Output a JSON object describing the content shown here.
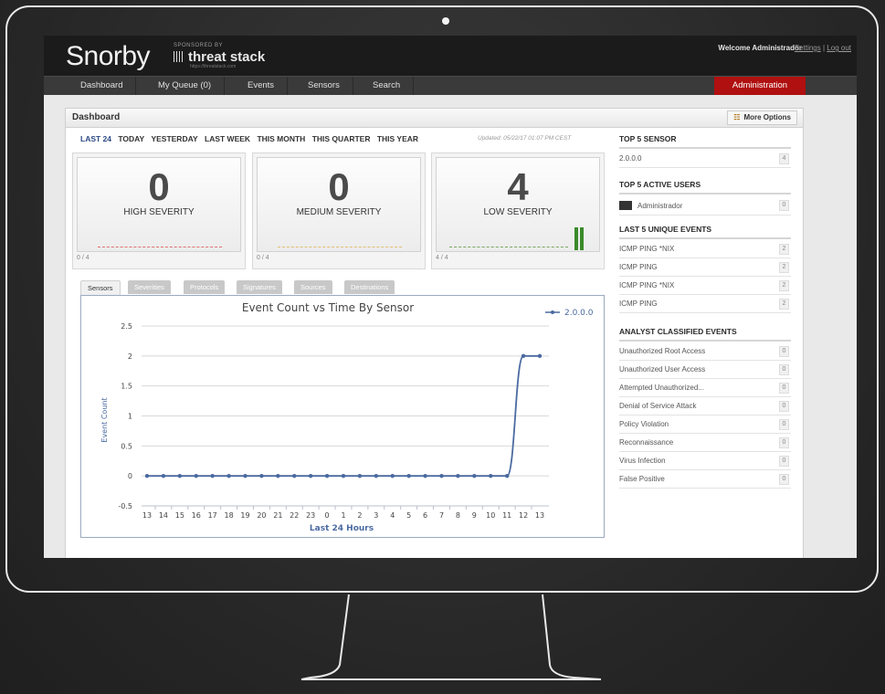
{
  "header": {
    "logo": "Snorby",
    "sponsored_by": "SPONSORED BY",
    "sponsor_name": "threat stack",
    "sponsor_url": "https://threatstack.com",
    "welcome": "Welcome Administrador",
    "settings": "Settings",
    "separator": "|",
    "logout": "Log out"
  },
  "nav": {
    "items": [
      "Dashboard",
      "My Queue (0)",
      "Events",
      "Sensors",
      "Search"
    ],
    "admin": "Administration"
  },
  "dashboard": {
    "title": "Dashboard",
    "more_options": "More Options",
    "more_options_icon": "grid-icon",
    "timeframes": [
      "LAST 24",
      "TODAY",
      "YESTERDAY",
      "LAST WEEK",
      "THIS MONTH",
      "THIS QUARTER",
      "THIS YEAR"
    ],
    "updated": "Updated: 05/22/17 01:07 PM CEST",
    "cards": [
      {
        "count": "0",
        "label": "HIGH SEVERITY",
        "fraction": "0 / 4",
        "color": "#e07070"
      },
      {
        "count": "0",
        "label": "MEDIUM SEVERITY",
        "fraction": "0 / 4",
        "color": "#e0c070"
      },
      {
        "count": "4",
        "label": "LOW SEVERITY",
        "fraction": "4 / 4",
        "color": "#7aa860"
      }
    ],
    "tabs": [
      "Sensors",
      "Severities",
      "Protocols",
      "Signatures",
      "Sources",
      "Destinations"
    ]
  },
  "chart_data": {
    "type": "line",
    "title": "Event Count vs Time By Sensor",
    "xlabel": "Last 24 Hours",
    "ylabel": "Event Count",
    "categories": [
      "13",
      "14",
      "15",
      "16",
      "17",
      "18",
      "19",
      "20",
      "21",
      "22",
      "23",
      "0",
      "1",
      "2",
      "3",
      "4",
      "5",
      "6",
      "7",
      "8",
      "9",
      "10",
      "11",
      "12",
      "13"
    ],
    "series": [
      {
        "name": "2.0.0.0",
        "values": [
          0,
          0,
          0,
          0,
          0,
          0,
          0,
          0,
          0,
          0,
          0,
          0,
          0,
          0,
          0,
          0,
          0,
          0,
          0,
          0,
          0,
          0,
          0,
          2,
          2
        ],
        "color": "#4a6aa0"
      }
    ],
    "ylim": [
      -0.5,
      2.5
    ],
    "yticks": [
      "-0.5",
      "0",
      "0.5",
      "1",
      "1.5",
      "2",
      "2.5"
    ],
    "grid": true,
    "legend": "top-right"
  },
  "sidebar": {
    "top_sensor": {
      "title": "TOP 5 SENSOR",
      "items": [
        {
          "label": "2.0.0.0",
          "count": "4"
        }
      ]
    },
    "active_users": {
      "title": "TOP 5 ACTIVE USERS",
      "items": [
        {
          "label": "Administrador",
          "count": "0"
        }
      ]
    },
    "unique_events": {
      "title": "LAST 5 UNIQUE EVENTS",
      "items": [
        {
          "label": "ICMP PING *NIX",
          "count": "2"
        },
        {
          "label": "ICMP PING",
          "count": "2"
        },
        {
          "label": "ICMP PING *NIX",
          "count": "2"
        },
        {
          "label": "ICMP PING",
          "count": "2"
        }
      ]
    },
    "classified": {
      "title": "ANALYST CLASSIFIED EVENTS",
      "items": [
        {
          "label": "Unauthorized Root Access",
          "count": "0"
        },
        {
          "label": "Unauthorized User Access",
          "count": "0"
        },
        {
          "label": "Attempted Unauthorized...",
          "count": "0"
        },
        {
          "label": "Denial of Service Attack",
          "count": "0"
        },
        {
          "label": "Policy Violation",
          "count": "0"
        },
        {
          "label": "Reconnaissance",
          "count": "0"
        },
        {
          "label": "Virus Infection",
          "count": "0"
        },
        {
          "label": "False Positive",
          "count": "0"
        }
      ]
    }
  }
}
